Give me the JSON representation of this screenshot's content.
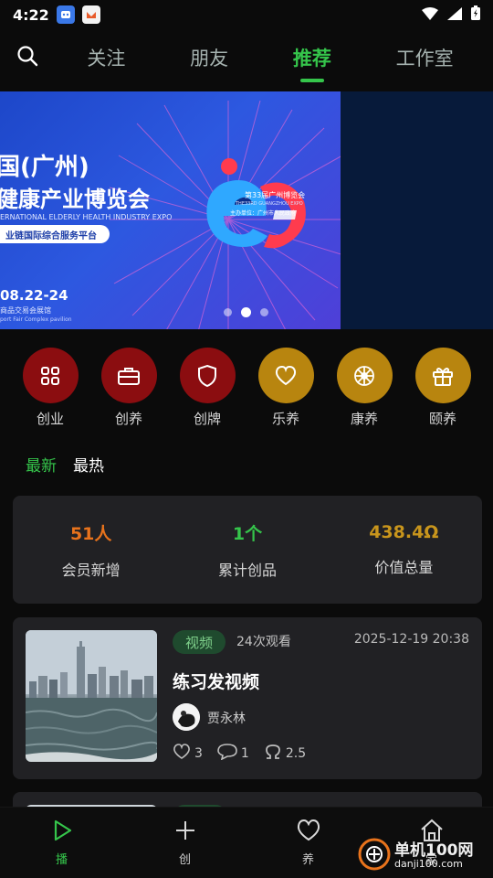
{
  "status_bar": {
    "time": "4:22"
  },
  "nav": {
    "tabs": [
      {
        "label": "关注"
      },
      {
        "label": "朋友"
      },
      {
        "label": "推荐",
        "active": true
      },
      {
        "label": "工作室"
      }
    ]
  },
  "banner": {
    "title_line1": "国(广州)",
    "title_line2": "健康产业博览会",
    "subtitle_en": "ERNATIONAL ELDERLY HEALTH INDUSTRY EXPO",
    "pill": "业链国际综合服务平台",
    "date": "08.22-24",
    "venue": "商品交易会展馆",
    "venue_en": "port Fair Complex pavilion",
    "logo_title": "第33届广州博览会",
    "logo_sub": "THE33RD GUANGZHOU EXPO",
    "organizer": "主办单位：广州市人民政府",
    "active_dot": 1
  },
  "categories": [
    {
      "label": "创业",
      "icon": "grid-icon",
      "color": "#8b0d10"
    },
    {
      "label": "创养",
      "icon": "briefcase-icon",
      "color": "#8b0d10"
    },
    {
      "label": "创牌",
      "icon": "shield-icon",
      "color": "#8b0d10"
    },
    {
      "label": "乐养",
      "icon": "heart-icon",
      "color": "#b8850f"
    },
    {
      "label": "康养",
      "icon": "flower-icon",
      "color": "#b8850f"
    },
    {
      "label": "颐养",
      "icon": "gift-icon",
      "color": "#b8850f"
    }
  ],
  "subtabs": {
    "latest": "最新",
    "hottest": "最热"
  },
  "stats": [
    {
      "value": "51人",
      "label": "会员新增",
      "color": "#e8731c"
    },
    {
      "value": "1个",
      "label": "累计创品",
      "color": "#35c54b"
    },
    {
      "value": "438.4Ω",
      "label": "价值总量",
      "color": "#c8951c"
    }
  ],
  "video": {
    "tag": "视频",
    "views": "24次观看",
    "datetime": "2025-12-19 20:38",
    "title": "练习发视频",
    "author": "贾永林",
    "likes": "3",
    "comments": "1",
    "shares": "2.5"
  },
  "bottom_nav": [
    {
      "label": "播",
      "icon": "play-icon",
      "active": true
    },
    {
      "label": "创",
      "icon": "plus-icon"
    },
    {
      "label": "养",
      "icon": "heart-outline-icon"
    },
    {
      "label": "家",
      "icon": "home-icon"
    }
  ],
  "watermark": {
    "line1": "单机100网",
    "line2": "danji100.com"
  },
  "colors": {
    "accent": "#35c54b",
    "background": "#0b0b0b",
    "card": "#212124"
  }
}
